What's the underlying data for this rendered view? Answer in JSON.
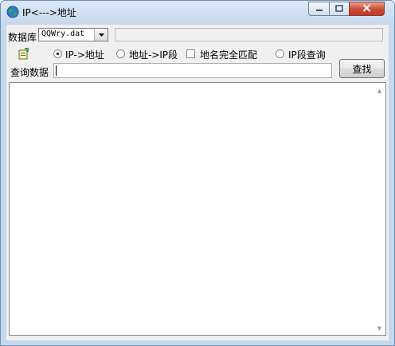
{
  "window": {
    "title": "IP<--->地址",
    "icon": "globe-icon",
    "controls": {
      "minimize": "minimize-icon",
      "maximize": "maximize-icon",
      "close": "close-icon"
    }
  },
  "database": {
    "label": "数据库",
    "selected": "QQWry.dat"
  },
  "modes": {
    "ip_to_address": "IP->地址",
    "address_to_ip_range": "地址->IP段",
    "exact_match": "地名完全匹配",
    "ip_range_query": "IP段查询",
    "selected": "ip_to_address",
    "exact_match_checked": false
  },
  "query": {
    "label": "查询数据",
    "value": "",
    "find_button": "查找"
  },
  "results": {
    "text": ""
  }
}
